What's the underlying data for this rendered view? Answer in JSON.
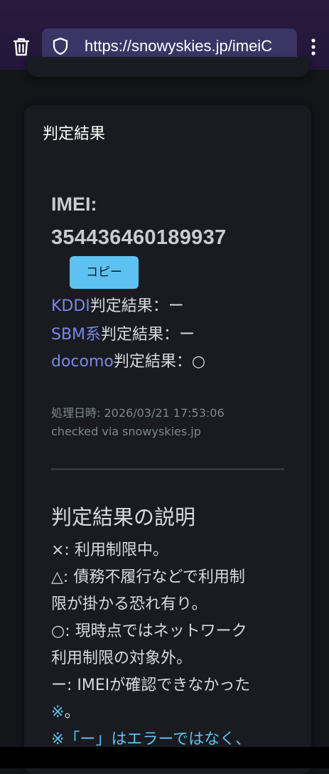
{
  "browser": {
    "url": "https://snowyskies.jp/imeiC"
  },
  "card": {
    "title": "判定結果",
    "imei_label": "IMEI:",
    "imei_value": "354436460189937",
    "copy_button": "コピー",
    "results": [
      {
        "carrier": "KDDI",
        "suffix": "判定結果：ー"
      },
      {
        "carrier": "SBM系",
        "suffix": "判定結果：ー"
      },
      {
        "carrier": "docomo",
        "suffix": "判定結果：○"
      }
    ],
    "processed_at": "処理日時: 2026/03/21 17:53:06",
    "checked_via": "checked via snowyskies.jp"
  },
  "explanation": {
    "title": "判定結果の説明",
    "lines": [
      "×: 利用制限中。",
      "△: 債務不履行などで利用制",
      "限が掛かる恐れ有り。",
      "○: 現時点ではネットワーク",
      "利用制限の対象外。",
      "ー: IMEIが確認できなかった"
    ],
    "note_mark": "※",
    "note_end": "。",
    "note_line": "※「ー」はエラーではなく、"
  },
  "colors": {
    "accent": "#5ec2f0",
    "link": "#7b88e8",
    "background": "#131518",
    "card": "#191b20"
  },
  "icons": [
    "trash-icon",
    "shield-icon",
    "more-vertical-icon"
  ]
}
